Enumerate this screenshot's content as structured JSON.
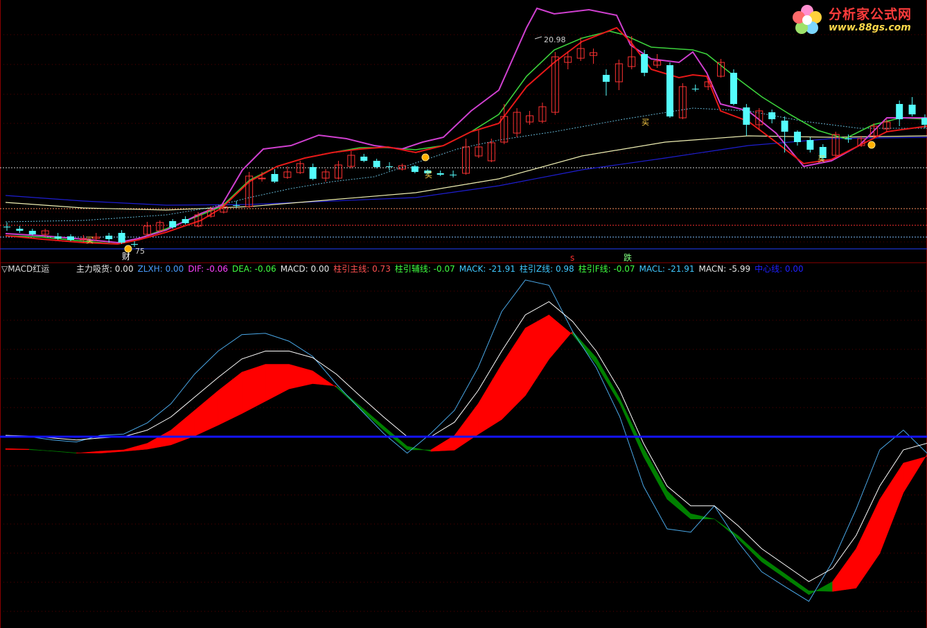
{
  "colors": {
    "background": "#000000",
    "candle_up": "#ff3232",
    "candle_down": "#54fcfc",
    "ma_red": "#e81818",
    "ma_magenta": "#d040d0",
    "ma_green": "#3cd23c",
    "ma_pale": "#f0f0b4",
    "ma_blue": "#1e1ed2",
    "ma_dotted": "#64b4d2",
    "macd_red": "#ff0000",
    "macd_green": "#008000",
    "dif_line": "#4aa8e8",
    "dea_line": "#ffffff",
    "zero_line": "#1414ff"
  },
  "logo": {
    "cn": "分析家公式网",
    "url": "www.88gs.com"
  },
  "price_annotations": {
    "high_label": "20.98",
    "low_label": "75"
  },
  "signals": {
    "buy": "买",
    "cai": "财",
    "fall": "跌",
    "s": "s"
  },
  "indicator": {
    "name": "MACD红运",
    "items": [
      {
        "label": "主力吸货: 0.00",
        "color": "#e6e6e6"
      },
      {
        "label": "ZLXH: 0.00",
        "color": "#4a9cff"
      },
      {
        "label": "DIF: -0.06",
        "color": "#ff40ff"
      },
      {
        "label": "DEA: -0.06",
        "color": "#40ff40"
      },
      {
        "label": "MACD: 0.00",
        "color": "#e6e6e6"
      },
      {
        "label": "柱引主线: 0.73",
        "color": "#ff5050"
      },
      {
        "label": "柱引辅线: -0.07",
        "color": "#40ff40"
      },
      {
        "label": "MACK: -21.91",
        "color": "#40c8ff"
      },
      {
        "label": "柱引Z线: 0.98",
        "color": "#40c8ff"
      },
      {
        "label": "柱引F线: -0.07",
        "color": "#40ff40"
      },
      {
        "label": "MACL: -21.91",
        "color": "#40c8ff"
      },
      {
        "label": "MACN: -5.99",
        "color": "#e6e6e6"
      },
      {
        "label": "中心线: 0.00",
        "color": "#2020ff"
      }
    ]
  },
  "chart_data": [
    {
      "type": "candlestick",
      "title": "",
      "candles": [
        {
          "o": 327,
          "c": 327,
          "h": 321,
          "l": 333
        },
        {
          "o": 330,
          "c": 333,
          "h": 326,
          "l": 336
        },
        {
          "o": 333,
          "c": 338,
          "h": 330,
          "l": 340
        },
        {
          "o": 338,
          "c": 333,
          "h": 330,
          "l": 342
        },
        {
          "o": 341,
          "c": 344,
          "h": 336,
          "l": 346
        },
        {
          "o": 341,
          "c": 346,
          "h": 338,
          "l": 348
        },
        {
          "o": 346,
          "c": 344,
          "h": 339,
          "l": 350
        },
        {
          "o": 344,
          "c": 342,
          "h": 336,
          "l": 348
        },
        {
          "o": 340,
          "c": 345,
          "h": 336,
          "l": 350
        },
        {
          "o": 336,
          "c": 350,
          "h": 332,
          "l": 352
        },
        {
          "o": 352,
          "c": 352,
          "h": 348,
          "l": 356
        },
        {
          "o": 338,
          "c": 326,
          "h": 320,
          "l": 340
        },
        {
          "o": 333,
          "c": 321,
          "h": 318,
          "l": 335
        },
        {
          "o": 319,
          "c": 328,
          "h": 316,
          "l": 330
        },
        {
          "o": 316,
          "c": 322,
          "h": 312,
          "l": 324
        },
        {
          "o": 326,
          "c": 310,
          "h": 306,
          "l": 328
        },
        {
          "o": 312,
          "c": 303,
          "h": 298,
          "l": 314
        },
        {
          "o": 306,
          "c": 298,
          "h": 293,
          "l": 308
        },
        {
          "o": 296,
          "c": 296,
          "h": 290,
          "l": 300
        },
        {
          "o": 298,
          "c": 254,
          "h": 248,
          "l": 300
        },
        {
          "o": 258,
          "c": 257,
          "h": 248,
          "l": 262
        },
        {
          "o": 251,
          "c": 262,
          "h": 244,
          "l": 264
        },
        {
          "o": 256,
          "c": 248,
          "h": 240,
          "l": 258
        },
        {
          "o": 249,
          "c": 236,
          "h": 232,
          "l": 251
        },
        {
          "o": 241,
          "c": 258,
          "h": 236,
          "l": 260
        },
        {
          "o": 257,
          "c": 248,
          "h": 244,
          "l": 262
        },
        {
          "o": 257,
          "c": 238,
          "h": 232,
          "l": 259
        },
        {
          "o": 240,
          "c": 224,
          "h": 218,
          "l": 243
        },
        {
          "o": 226,
          "c": 232,
          "h": 222,
          "l": 234
        },
        {
          "o": 232,
          "c": 241,
          "h": 229,
          "l": 243
        },
        {
          "o": 240,
          "c": 240,
          "h": 234,
          "l": 246
        },
        {
          "o": 244,
          "c": 239,
          "h": 236,
          "l": 246
        },
        {
          "o": 240,
          "c": 248,
          "h": 238,
          "l": 250
        },
        {
          "o": 246,
          "c": 250,
          "h": 244,
          "l": 252
        },
        {
          "o": 250,
          "c": 252,
          "h": 246,
          "l": 254
        },
        {
          "o": 252,
          "c": 252,
          "h": 246,
          "l": 256
        },
        {
          "o": 250,
          "c": 212,
          "h": 200,
          "l": 252
        },
        {
          "o": 225,
          "c": 212,
          "h": 188,
          "l": 228
        },
        {
          "o": 232,
          "c": 206,
          "h": 200,
          "l": 234
        },
        {
          "o": 205,
          "c": 168,
          "h": 150,
          "l": 208
        },
        {
          "o": 192,
          "c": 162,
          "h": 156,
          "l": 198
        },
        {
          "o": 176,
          "c": 167,
          "h": 160,
          "l": 180
        },
        {
          "o": 175,
          "c": 154,
          "h": 148,
          "l": 178
        },
        {
          "o": 162,
          "c": 82,
          "h": 75,
          "l": 166
        },
        {
          "o": 90,
          "c": 82,
          "h": 74,
          "l": 100
        },
        {
          "o": 84,
          "c": 70,
          "h": 54,
          "l": 88
        },
        {
          "o": 80,
          "c": 76,
          "h": 70,
          "l": 92
        },
        {
          "o": 108,
          "c": 118,
          "h": 100,
          "l": 138
        },
        {
          "o": 118,
          "c": 92,
          "h": 86,
          "l": 130
        },
        {
          "o": 96,
          "c": 82,
          "h": 52,
          "l": 100
        },
        {
          "o": 78,
          "c": 105,
          "h": 72,
          "l": 110
        },
        {
          "o": 94,
          "c": 88,
          "h": 78,
          "l": 98
        },
        {
          "o": 94,
          "c": 168,
          "h": 90,
          "l": 170
        },
        {
          "o": 170,
          "c": 125,
          "h": 120,
          "l": 172
        },
        {
          "o": 128,
          "c": 128,
          "h": 122,
          "l": 132
        },
        {
          "o": 125,
          "c": 118,
          "h": 112,
          "l": 130
        },
        {
          "o": 110,
          "c": 90,
          "h": 85,
          "l": 112
        },
        {
          "o": 105,
          "c": 150,
          "h": 100,
          "l": 152
        },
        {
          "o": 155,
          "c": 180,
          "h": 150,
          "l": 196
        },
        {
          "o": 180,
          "c": 160,
          "h": 156,
          "l": 188
        },
        {
          "o": 162,
          "c": 172,
          "h": 158,
          "l": 178
        },
        {
          "o": 174,
          "c": 190,
          "h": 168,
          "l": 220
        },
        {
          "o": 190,
          "c": 205,
          "h": 188,
          "l": 210
        },
        {
          "o": 202,
          "c": 216,
          "h": 198,
          "l": 220
        },
        {
          "o": 212,
          "c": 228,
          "h": 208,
          "l": 232
        },
        {
          "o": 224,
          "c": 194,
          "h": 190,
          "l": 226
        },
        {
          "o": 200,
          "c": 200,
          "h": 194,
          "l": 206
        },
        {
          "o": 210,
          "c": 200,
          "h": 196,
          "l": 212
        },
        {
          "o": 196,
          "c": 182,
          "h": 178,
          "l": 200
        },
        {
          "o": 186,
          "c": 176,
          "h": 172,
          "l": 190
        },
        {
          "o": 150,
          "c": 172,
          "h": 145,
          "l": 182
        },
        {
          "o": 151,
          "c": 165,
          "h": 140,
          "l": 168
        },
        {
          "o": 170,
          "c": 180,
          "h": 165,
          "l": 185
        }
      ]
    },
    {
      "type": "area",
      "title": "MACD红运",
      "series": [
        {
          "name": "DIF",
          "values": [
            0.02,
            0.0,
            -0.05,
            -0.08,
            0.02,
            0.04,
            0.21,
            0.5,
            0.95,
            1.3,
            1.55,
            1.57,
            1.45,
            1.22,
            0.8,
            0.42,
            0.05,
            -0.25,
            0.05,
            0.4,
            1.05,
            1.9,
            2.38,
            2.3,
            1.6,
            1.05,
            0.3,
            -0.75,
            -1.4,
            -1.45,
            -1.05,
            -1.6,
            -2.05,
            -2.28,
            -2.5,
            -1.9,
            -1.1,
            -0.2,
            0.1,
            -0.25
          ]
        },
        {
          "name": "DEA",
          "values": [
            0.02,
            0.01,
            -0.02,
            -0.05,
            -0.02,
            0.0,
            0.1,
            0.3,
            0.6,
            0.9,
            1.18,
            1.3,
            1.3,
            1.2,
            0.95,
            0.62,
            0.3,
            0.0,
            0.0,
            0.22,
            0.7,
            1.3,
            1.85,
            2.05,
            1.75,
            1.3,
            0.7,
            -0.1,
            -0.75,
            -1.05,
            -1.05,
            -1.35,
            -1.7,
            -1.95,
            -2.2,
            -2.0,
            -1.5,
            -0.75,
            -0.2,
            -0.1
          ]
        },
        {
          "name": "MACD",
          "values": [
            0.02,
            0.01,
            -0.03,
            -0.04,
            0.04,
            0.03,
            0.12,
            0.3,
            0.52,
            0.7,
            0.84,
            0.75,
            0.5,
            0.26,
            -0.2,
            -0.5,
            -0.62,
            -0.55,
            0.03,
            0.3,
            0.62,
            1.12,
            1.37,
            0.9,
            -0.5,
            -1.04,
            -0.8,
            -1.3,
            -1.3,
            -0.8,
            0.0,
            -0.5,
            -0.7,
            -0.66,
            -0.6,
            0.2,
            0.8,
            1.1,
            0.6,
            -0.3
          ]
        }
      ],
      "zero_line": 0
    }
  ]
}
